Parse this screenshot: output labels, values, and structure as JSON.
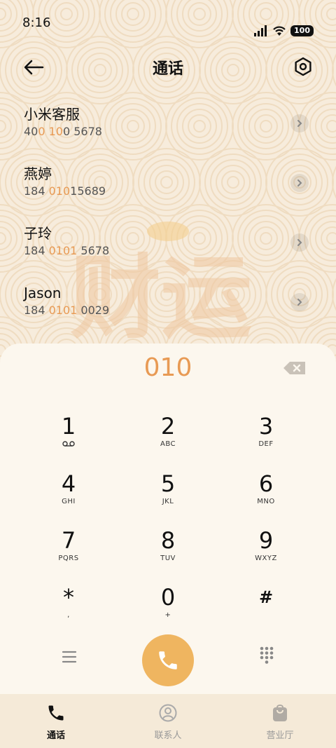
{
  "status": {
    "time": "8:16",
    "battery": "100"
  },
  "header": {
    "title": "通话",
    "back_icon": "arrow-left-icon",
    "settings_icon": "hexagon-settings-icon"
  },
  "watermark": {
    "text": "财运"
  },
  "contacts": [
    {
      "name": "小米客服",
      "number_parts": [
        "40",
        "0 10",
        "0 5678"
      ]
    },
    {
      "name": "燕婷",
      "number_parts": [
        "184 ",
        "010",
        "15689"
      ]
    },
    {
      "name": "子玲",
      "number_parts": [
        "184 ",
        "0101",
        " 5678"
      ]
    },
    {
      "name": "Jason",
      "number_parts": [
        "184 ",
        "0101",
        " 0029"
      ]
    }
  ],
  "dialer": {
    "input": "010",
    "keys": [
      {
        "digit": "1",
        "letters": "voicemail"
      },
      {
        "digit": "2",
        "letters": "ABC"
      },
      {
        "digit": "3",
        "letters": "DEF"
      },
      {
        "digit": "4",
        "letters": "GHI"
      },
      {
        "digit": "5",
        "letters": "JKL"
      },
      {
        "digit": "6",
        "letters": "MNO"
      },
      {
        "digit": "7",
        "letters": "PQRS"
      },
      {
        "digit": "8",
        "letters": "TUV"
      },
      {
        "digit": "9",
        "letters": "WXYZ"
      },
      {
        "digit": "*",
        "letters": ","
      },
      {
        "digit": "0",
        "letters": "+"
      },
      {
        "digit": "#",
        "letters": ""
      }
    ]
  },
  "nav": [
    {
      "label": "通话",
      "icon": "phone-icon",
      "active": true
    },
    {
      "label": "联系人",
      "icon": "person-icon",
      "active": false
    },
    {
      "label": "营业厅",
      "icon": "shopping-bag-icon",
      "active": false
    }
  ],
  "colors": {
    "accent": "#e89a54",
    "call_button": "#efb560",
    "panel": "#fcf7ee",
    "background": "#f7ecdc"
  }
}
